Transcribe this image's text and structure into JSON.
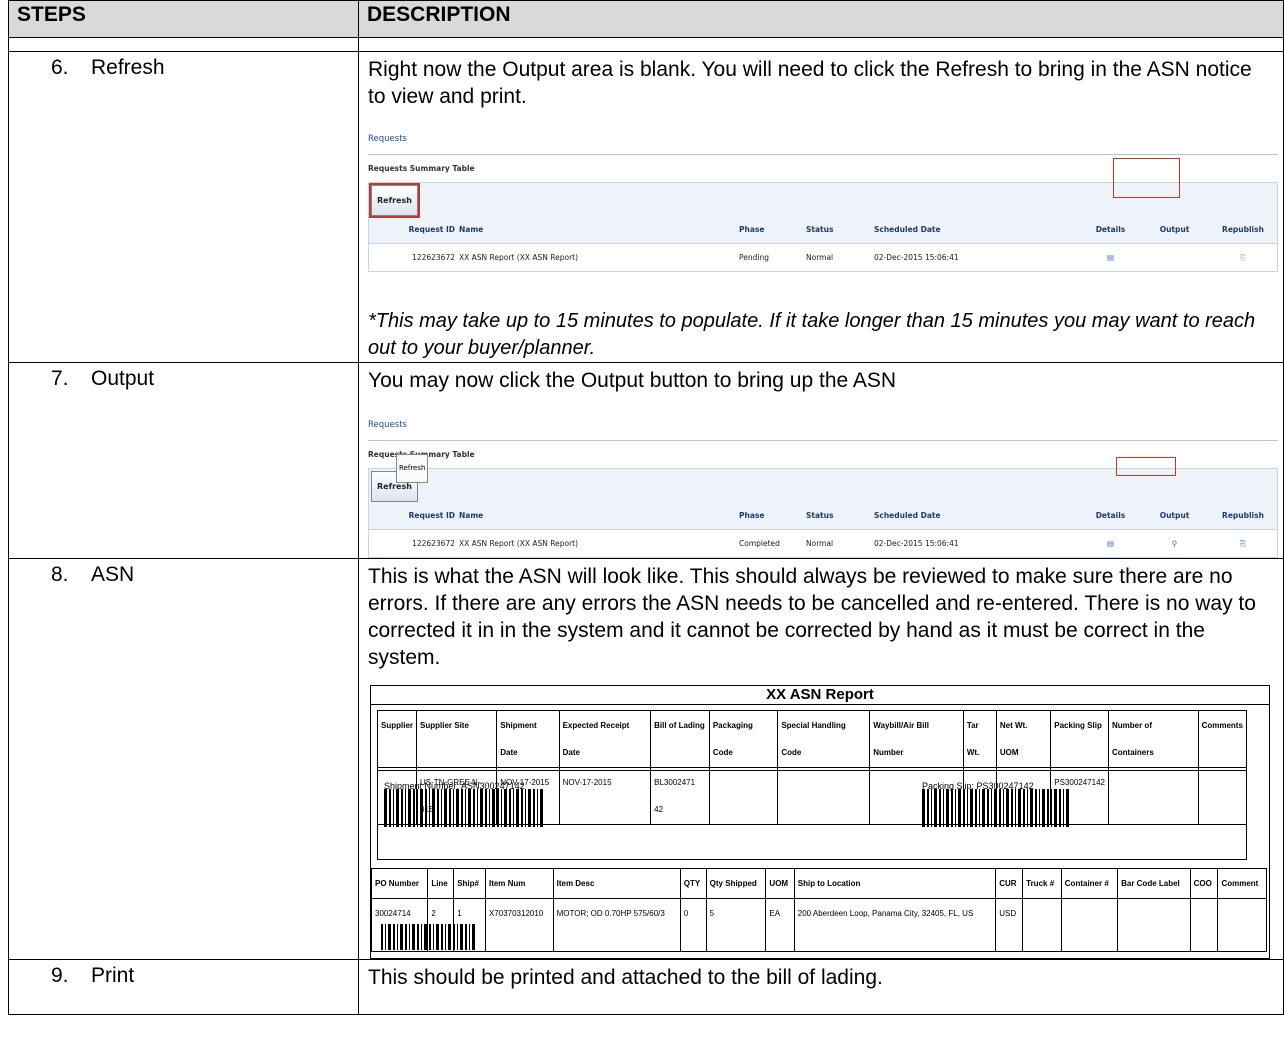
{
  "headers": {
    "steps": "STEPS",
    "description": "DESCRIPTION"
  },
  "steps": [
    {
      "num": "6.",
      "label": "Refresh",
      "desc": "Right now the Output area is blank. You will need to click the Refresh to bring in the ASN notice to view and print.",
      "note": "*This may take up to 15 minutes to populate. If it take longer than 15 minutes you may want to reach out to your buyer/planner."
    },
    {
      "num": "7.",
      "label": "Output",
      "desc": "You may now click the Output button to bring up the ASN"
    },
    {
      "num": "8.",
      "label": "ASN",
      "desc": "This is what the ASN will look like. This should always be reviewed to make sure there are no errors. If there are any errors the ASN needs to be cancelled and re-entered. There is no way to corrected it in in the system and it cannot be corrected by hand as it must be correct in the system."
    },
    {
      "num": "9.",
      "label": "Print",
      "desc": "This should be printed and attached to the bill of lading."
    }
  ],
  "req1": {
    "title": "Requests",
    "subtitle": "Requests Summary Table",
    "refresh": "Refresh",
    "cols": [
      "Request ID",
      "Name",
      "Phase",
      "Status",
      "Scheduled Date",
      "Details",
      "Output",
      "Republish"
    ],
    "row": {
      "id": "122623672",
      "name": "XX ASN Report (XX ASN Report)",
      "phase": "Pending",
      "status": "Normal",
      "date": "02-Dec-2015 15:06:41"
    }
  },
  "req2": {
    "title": "Requests",
    "subtitle": "Requests Summary Table",
    "refresh": "Refresh",
    "tooltip": "Refresh",
    "cols": [
      "Request ID",
      "Name",
      "Phase",
      "Status",
      "Scheduled Date",
      "Details",
      "Output",
      "Republish"
    ],
    "row": {
      "id": "122623672",
      "name": "XX ASN Report (XX ASN Report)",
      "phase": "Completed",
      "status": "Normal",
      "date": "02-Dec-2015 15:06:41"
    }
  },
  "asn": {
    "title": "XX ASN Report",
    "h1": [
      "Supplier",
      "Supplier Site",
      "Shipment Date",
      "Expected Receipt Date",
      "Bill of Lading",
      "Packaging Code",
      "Special Handling Code",
      "Waybill/Air Bill Number",
      "Tar Wt.",
      "Net Wt. UOM",
      "Packing Slip",
      "Number of Containers",
      "Comments"
    ],
    "r1": [
      "",
      "US-TN-GREE N-01E",
      "NOV-17-2015",
      "NOV-17-2015",
      "BL3002471 42",
      "",
      "",
      "",
      "",
      "",
      "PS300247142",
      "",
      ""
    ],
    "shipment": "Shipment Number: ASN300247142",
    "packing": "Packing Slip: PS300247142",
    "h2": [
      "PO Number",
      "Line",
      "Ship#",
      "Item Num",
      "Item Desc",
      "QTY",
      "Qty Shipped",
      "UOM",
      "Ship to Location",
      "CUR",
      "Truck #",
      "Container #",
      "Bar Code Label",
      "COO",
      "Comment"
    ],
    "r2": [
      "30024714",
      "2",
      "1",
      "X70370312010",
      "MOTOR; OD 0.70HP 575/60/3",
      "0",
      "5",
      "EA",
      "200 Aberdeen Loop, Panama City, 32405, FL, US",
      "USD",
      "",
      "",
      "",
      "",
      ""
    ]
  }
}
